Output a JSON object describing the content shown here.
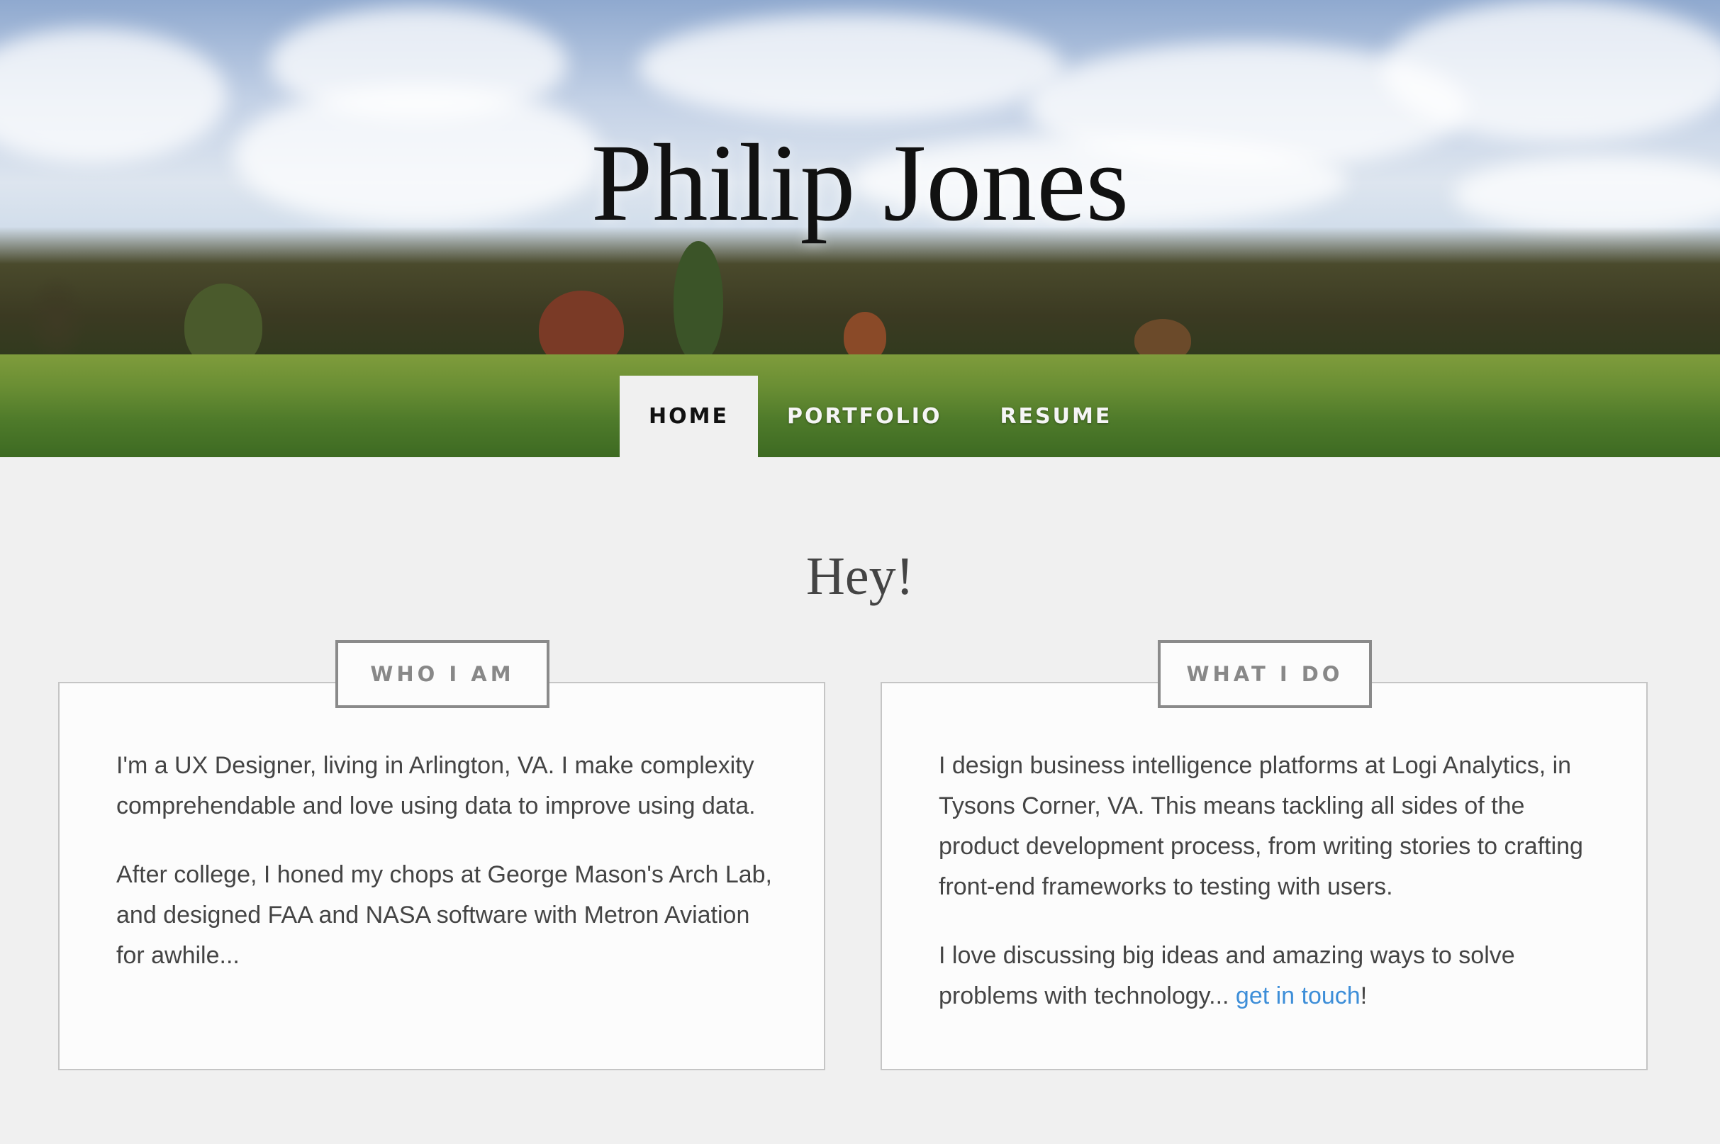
{
  "header": {
    "title": "Philip Jones"
  },
  "nav": {
    "items": [
      {
        "label": "HOME",
        "active": true
      },
      {
        "label": "PORTFOLIO",
        "active": false
      },
      {
        "label": "RESUME",
        "active": false
      }
    ]
  },
  "main": {
    "greeting": "Hey!",
    "who_i_am": {
      "tag": "WHO I AM",
      "paragraphs": [
        "I'm a UX Designer, living in Arlington, VA. I make complexity comprehendable and love using data to improve using data.",
        "After college, I honed my chops at George Mason's Arch Lab, and designed FAA and NASA software with Metron Aviation for awhile..."
      ]
    },
    "what_i_do": {
      "tag": "WHAT I DO",
      "paragraph1": "I design business intelligence platforms at Logi Analytics, in Tysons Corner, VA. This means tackling all sides of the product development process, from writing stories to crafting front-end frameworks to testing with users.",
      "paragraph2_prefix": "I love discussing big ideas and amazing ways to solve problems with technology... ",
      "paragraph2_link": "get in touch",
      "paragraph2_suffix": "!"
    }
  },
  "colors": {
    "background": "#f0f0f0",
    "card": "#fcfcfc",
    "text": "#444444",
    "link": "#3d8ed8",
    "tag_border": "#8a8a8a"
  }
}
